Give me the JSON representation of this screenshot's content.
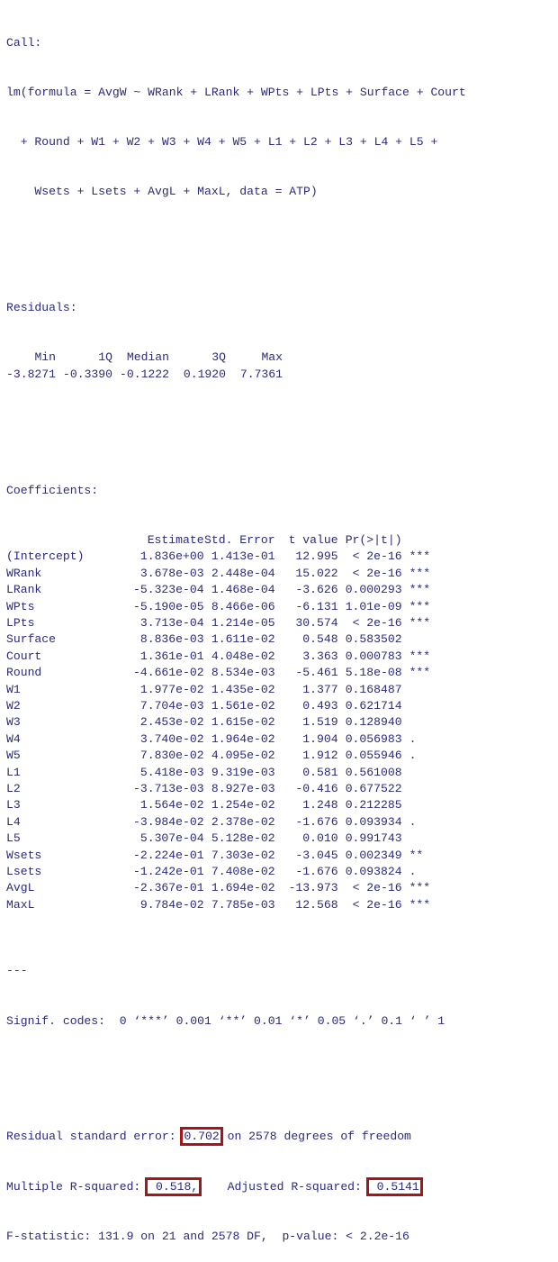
{
  "call": {
    "label": "Call:",
    "lines": [
      "lm(formula = AvgW ~ WRank + LRank + WPts + LPts + Surface + Court",
      "  + Round + W1 + W2 + W3 + W4 + W5 + L1 + L2 + L3 + L4 + L5 +",
      "    Wsets + Lsets + AvgL + MaxL, data = ATP)"
    ]
  },
  "residuals": {
    "label": "Residuals:",
    "headers": [
      "Min",
      "1Q",
      "Median",
      "3Q",
      "Max"
    ],
    "values": [
      "-3.8271",
      "-0.3390",
      "-0.1222",
      "0.1920",
      "7.7361"
    ]
  },
  "coefficients": {
    "label": "Coefficients:",
    "headers": [
      "",
      "Estimate",
      "Std. Error",
      "t value",
      "Pr(>|t|)",
      ""
    ],
    "rows": [
      {
        "name": "(Intercept)",
        "estimate": "1.836e+00",
        "std_error": "1.413e-01",
        "t_value": "12.995",
        "p_value": "< 2e-16",
        "signif": "***"
      },
      {
        "name": "WRank",
        "estimate": "3.678e-03",
        "std_error": "2.448e-04",
        "t_value": "15.022",
        "p_value": "< 2e-16",
        "signif": "***"
      },
      {
        "name": "LRank",
        "estimate": "-5.323e-04",
        "std_error": "1.468e-04",
        "t_value": "-3.626",
        "p_value": "0.000293",
        "signif": "***"
      },
      {
        "name": "WPts",
        "estimate": "-5.190e-05",
        "std_error": "8.466e-06",
        "t_value": "-6.131",
        "p_value": "1.01e-09",
        "signif": "***"
      },
      {
        "name": "LPts",
        "estimate": "3.713e-04",
        "std_error": "1.214e-05",
        "t_value": "30.574",
        "p_value": "< 2e-16",
        "signif": "***"
      },
      {
        "name": "Surface",
        "estimate": "8.836e-03",
        "std_error": "1.611e-02",
        "t_value": "0.548",
        "p_value": "0.583502",
        "signif": ""
      },
      {
        "name": "Court",
        "estimate": "1.361e-01",
        "std_error": "4.048e-02",
        "t_value": "3.363",
        "p_value": "0.000783",
        "signif": "***"
      },
      {
        "name": "Round",
        "estimate": "-4.661e-02",
        "std_error": "8.534e-03",
        "t_value": "-5.461",
        "p_value": "5.18e-08",
        "signif": "***"
      },
      {
        "name": "W1",
        "estimate": "1.977e-02",
        "std_error": "1.435e-02",
        "t_value": "1.377",
        "p_value": "0.168487",
        "signif": ""
      },
      {
        "name": "W2",
        "estimate": "7.704e-03",
        "std_error": "1.561e-02",
        "t_value": "0.493",
        "p_value": "0.621714",
        "signif": ""
      },
      {
        "name": "W3",
        "estimate": "2.453e-02",
        "std_error": "1.615e-02",
        "t_value": "1.519",
        "p_value": "0.128940",
        "signif": ""
      },
      {
        "name": "W4",
        "estimate": "3.740e-02",
        "std_error": "1.964e-02",
        "t_value": "1.904",
        "p_value": "0.056983",
        "signif": "."
      },
      {
        "name": "W5",
        "estimate": "7.830e-02",
        "std_error": "4.095e-02",
        "t_value": "1.912",
        "p_value": "0.055946",
        "signif": "."
      },
      {
        "name": "L1",
        "estimate": "5.418e-03",
        "std_error": "9.319e-03",
        "t_value": "0.581",
        "p_value": "0.561008",
        "signif": ""
      },
      {
        "name": "L2",
        "estimate": "-3.713e-03",
        "std_error": "8.927e-03",
        "t_value": "-0.416",
        "p_value": "0.677522",
        "signif": ""
      },
      {
        "name": "L3",
        "estimate": "1.564e-02",
        "std_error": "1.254e-02",
        "t_value": "1.248",
        "p_value": "0.212285",
        "signif": ""
      },
      {
        "name": "L4",
        "estimate": "-3.984e-02",
        "std_error": "2.378e-02",
        "t_value": "-1.676",
        "p_value": "0.093934",
        "signif": "."
      },
      {
        "name": "L5",
        "estimate": "5.307e-04",
        "std_error": "5.128e-02",
        "t_value": "0.010",
        "p_value": "0.991743",
        "signif": ""
      },
      {
        "name": "Wsets",
        "estimate": "-2.224e-01",
        "std_error": "7.303e-02",
        "t_value": "-3.045",
        "p_value": "0.002349",
        "signif": "**"
      },
      {
        "name": "Lsets",
        "estimate": "-1.242e-01",
        "std_error": "7.408e-02",
        "t_value": "-1.676",
        "p_value": "0.093824",
        "signif": "."
      },
      {
        "name": "AvgL",
        "estimate": "-2.367e-01",
        "std_error": "1.694e-02",
        "t_value": "-13.973",
        "p_value": "< 2e-16",
        "signif": "***"
      },
      {
        "name": "MaxL",
        "estimate": "9.784e-02",
        "std_error": "7.785e-03",
        "t_value": "12.568",
        "p_value": "< 2e-16",
        "signif": "***"
      }
    ]
  },
  "separator": "---",
  "signif_codes": "Signif. codes:  0 ‘***’ 0.001 ‘**’ 0.01 ‘*’ 0.05 ‘.’ 0.1 ‘ ’ 1",
  "summary": {
    "rse_prefix": "Residual standard error: ",
    "rse_value": "0.702",
    "rse_suffix": " on 2578 degrees of freedom",
    "r2_prefix": "Multiple R-squared: ",
    "r2_value": " 0.518,",
    "adj_r2_prefix": "    Adjusted R-squared: ",
    "adj_r2_value": " 0.5141",
    "fstat_line": "F-statistic: 131.9 on 21 and 2578 DF,  p-value: < 2.2e-16"
  },
  "colors": {
    "text": "#2a2a7e",
    "highlight_box": "#a3161a",
    "background": "#ffffff"
  }
}
